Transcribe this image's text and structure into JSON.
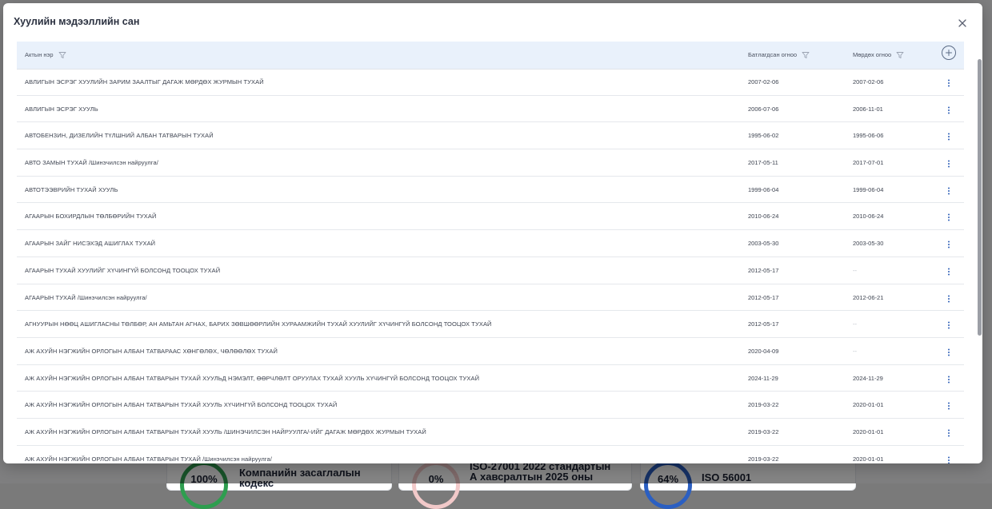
{
  "background": {
    "cards": [
      {
        "percent": "100%",
        "title_line1": "Компанийн засаглалын",
        "title_line2": "кодекс",
        "ring_color": "#2e9e4f"
      },
      {
        "percent": "0%",
        "title_line1": "ISO-27001 2022 стандартын",
        "title_line2": "А хавсралтын 2025 оны",
        "ring_color": "#f2c9c9"
      },
      {
        "percent": "64%",
        "title_line1": "ISO 56001",
        "title_line2": "",
        "ring_color": "#2b5fc2"
      }
    ]
  },
  "modal": {
    "title": "Хуулийн мэдээллийн сан",
    "close_icon": "close-icon"
  },
  "table": {
    "columns": {
      "name": "Актын нэр",
      "approved": "Батлагдсан огноо",
      "effective": "Мөрдөх огноо"
    },
    "rows": [
      {
        "name": "АВЛИГЫН ЭСРЭГ ХУУЛИЙН ЗАРИМ ЗААЛТЫГ ДАГАЖ МӨРДӨХ ЖУРМЫН ТУХАЙ",
        "approved": "2007-02-06",
        "effective": "2007-02-06"
      },
      {
        "name": "АВЛИГЫН ЭСРЭГ ХУУЛЬ",
        "approved": "2006-07-06",
        "effective": "2006-11-01"
      },
      {
        "name": "АВТОБЕНЗИН, ДИЗЕЛИЙН ТҮЛШНИЙ АЛБАН ТАТВАРЫН ТУХАЙ",
        "approved": "1995-06-02",
        "effective": "1995-06-06"
      },
      {
        "name": "АВТО ЗАМЫН ТУХАЙ /Шинэчилсэн найруулга/",
        "approved": "2017-05-11",
        "effective": "2017-07-01"
      },
      {
        "name": "АВТОТЭЭВРИЙН ТУХАЙ ХУУЛЬ",
        "approved": "1999-06-04",
        "effective": "1999-06-04"
      },
      {
        "name": "АГААРЫН БОХИРДЛЫН ТӨЛБӨРИЙН ТУХАЙ",
        "approved": "2010-06-24",
        "effective": "2010-06-24"
      },
      {
        "name": "АГААРЫН ЗАЙГ НИСЭХЭД АШИГЛАХ ТУХАЙ",
        "approved": "2003-05-30",
        "effective": "2003-05-30"
      },
      {
        "name": "АГААРЫН ТУХАЙ ХУУЛИЙГ ХҮЧИНГҮЙ БОЛСОНД ТООЦОХ ТУХАЙ",
        "approved": "2012-05-17",
        "effective": "--"
      },
      {
        "name": "АГААРЫН ТУХАЙ /Шинэчилсэн найруулга/",
        "approved": "2012-05-17",
        "effective": "2012-06-21"
      },
      {
        "name": "АГНУУРЫН НӨӨЦ АШИГЛАСНЫ ТӨЛБӨР, АН АМЬТАН АГНАХ, БАРИХ ЗӨВШӨӨРЛИЙН ХУРААМЖИЙН ТУХАЙ ХУУЛИЙГ ХҮЧИНГҮЙ БОЛСОНД ТООЦОХ ТУХАЙ",
        "approved": "2012-05-17",
        "effective": "--"
      },
      {
        "name": "АЖ АХУЙН НЭГЖИЙН ОРЛОГЫН АЛБАН ТАТВАРААС ХӨНГӨЛӨХ, ЧӨЛӨӨЛӨХ ТУХАЙ",
        "approved": "2020-04-09",
        "effective": "--"
      },
      {
        "name": "АЖ АХУЙН НЭГЖИЙН ОРЛОГЫН АЛБАН ТАТВАРЫН ТУХАЙ ХУУЛЬД НЭМЭЛТ, ӨӨРЧЛӨЛТ ОРУУЛАХ ТУХАЙ ХУУЛЬ ХҮЧИНГҮЙ БОЛСОНД ТООЦОХ ТУХАЙ",
        "approved": "2024-11-29",
        "effective": "2024-11-29"
      },
      {
        "name": "АЖ АХУЙН НЭГЖИЙН ОРЛОГЫН АЛБАН ТАТВАРЫН ТУХАЙ ХУУЛЬ ХҮЧИНГҮЙ БОЛСОНД ТООЦОХ ТУХАЙ",
        "approved": "2019-03-22",
        "effective": "2020-01-01"
      },
      {
        "name": "АЖ АХУЙН НЭГЖИЙН ОРЛОГЫН АЛБАН ТАТВАРЫН ТУХАЙ ХУУЛЬ /ШИНЭЧИЛСЭН НАЙРУУЛГА/-ИЙГ ДАГАЖ МӨРДӨХ ЖУРМЫН ТУХАЙ",
        "approved": "2019-03-22",
        "effective": "2020-01-01"
      },
      {
        "name": "АЖ АХУЙН НЭГЖИЙН ОРЛОГЫН АЛБАН ТАТВАРЫН ТУХАЙ /Шинэчилсэн найруулга/",
        "approved": "2019-03-22",
        "effective": "2020-01-01"
      }
    ]
  }
}
